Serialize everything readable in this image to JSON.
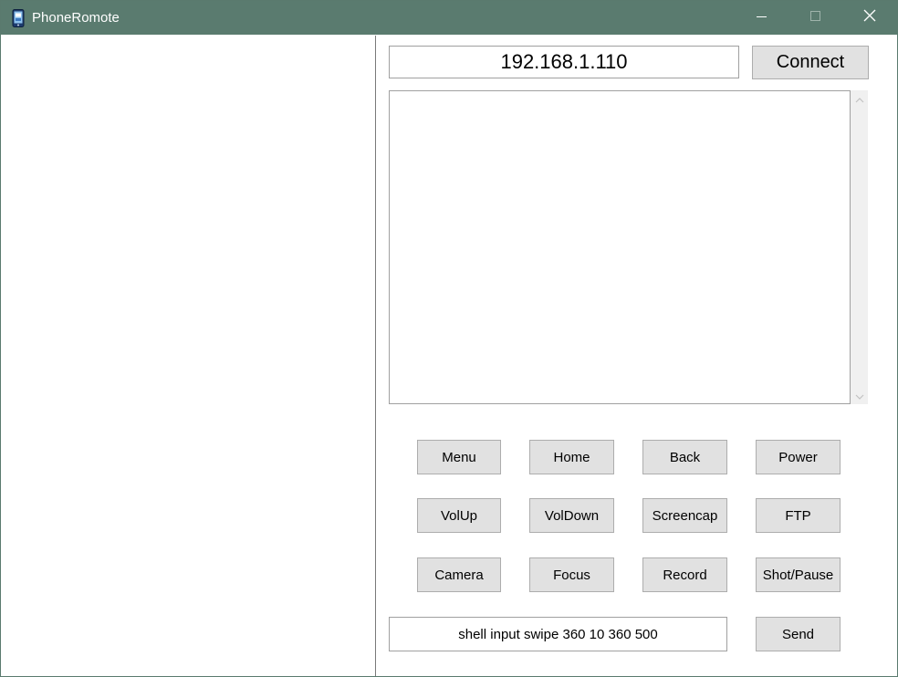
{
  "window": {
    "title": "PhoneRomote",
    "titlebar_color": "#5a7b6f"
  },
  "connection": {
    "ip_value": "192.168.1.110",
    "connect_label": "Connect"
  },
  "controls": {
    "row1": [
      "Menu",
      "Home",
      "Back",
      "Power"
    ],
    "row2": [
      "VolUp",
      "VolDown",
      "Screencap",
      "FTP"
    ],
    "row3": [
      "Camera",
      "Focus",
      "Record",
      "Shot/Pause"
    ]
  },
  "command": {
    "value": "shell input swipe 360 10 360 500",
    "send_label": "Send"
  },
  "icons": {
    "app": "phone-app-icon",
    "minimize": "minimize-icon",
    "maximize": "maximize-icon",
    "close": "close-icon",
    "scroll_up": "chevron-up-icon",
    "scroll_down": "chevron-down-icon"
  }
}
